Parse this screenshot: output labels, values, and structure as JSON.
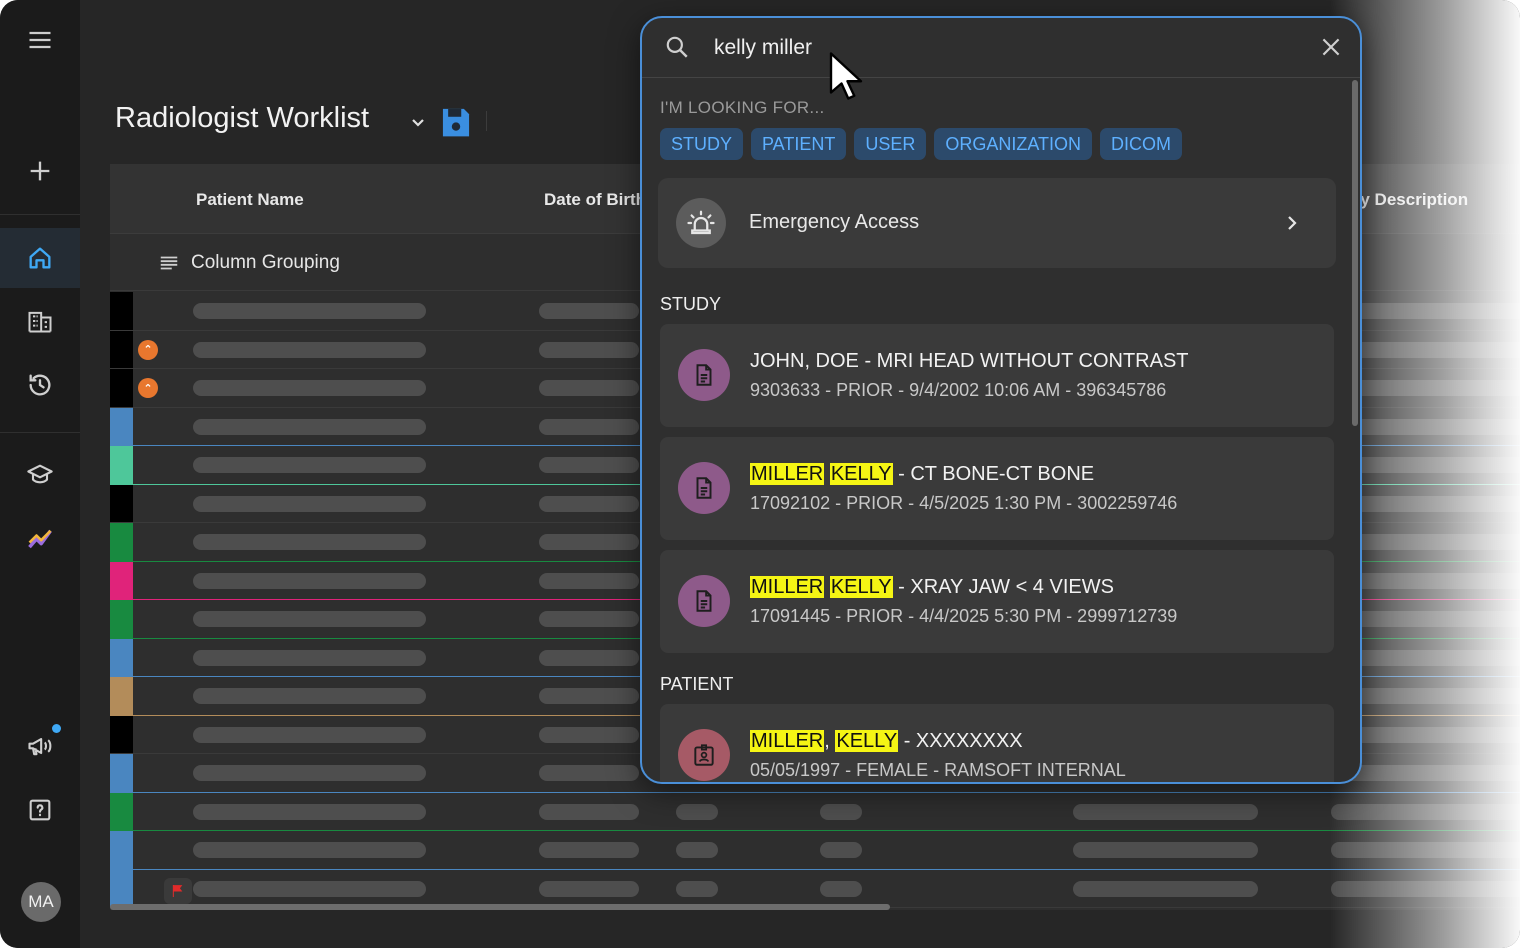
{
  "sidebar": {
    "items": [
      {
        "name": "menu",
        "icon": "hamburger-icon"
      },
      {
        "name": "add",
        "icon": "plus-icon"
      },
      {
        "name": "home",
        "icon": "home-icon",
        "active": true
      },
      {
        "name": "worklist",
        "icon": "building-icon"
      },
      {
        "name": "history",
        "icon": "history-icon"
      },
      {
        "name": "teaching",
        "icon": "graduation-cap-icon"
      },
      {
        "name": "analytics",
        "icon": "chart-icon"
      },
      {
        "name": "announcements",
        "icon": "megaphone-icon"
      },
      {
        "name": "help",
        "icon": "help-icon"
      }
    ],
    "avatar_initials": "MA",
    "accent_color": "#3fa9f5"
  },
  "header": {
    "title": "Radiologist Worklist"
  },
  "table": {
    "columns": [
      "Patient Name",
      "Date of Birth",
      "dy Description"
    ],
    "grouping_label": "Column Grouping",
    "row_colors": [
      "#000000",
      "#000000",
      "#000000",
      "#4a86c0",
      "#4ec79a",
      "#000000",
      "#188a40",
      "#e0237a",
      "#188a40",
      "#4a86c0",
      "#b38c5a",
      "#000000",
      "#4a86c0",
      "#188a40",
      "#4a86c0",
      "#4a86c0"
    ],
    "priority_rows": [
      1,
      2
    ],
    "flag_row": 15
  },
  "search": {
    "query": "kelly miller",
    "looking_for_label": "I'M LOOKING FOR...",
    "chips": [
      "STUDY",
      "PATIENT",
      "USER",
      "ORGANIZATION",
      "DICOM"
    ],
    "emergency_label": "Emergency Access",
    "study_section_label": "STUDY",
    "patient_section_label": "PATIENT",
    "studies": [
      {
        "title": "JOHN, DOE - MRI HEAD WITHOUT CONTRAST",
        "subtitle": "9303633 - PRIOR - 9/4/2002 10:06 AM - 396345786"
      },
      {
        "title_parts": [
          "MILLER",
          " ",
          "KELLY",
          " - CT BONE-CT BONE"
        ],
        "subtitle": "17092102 - PRIOR - 4/5/2025 1:30 PM - 3002259746"
      },
      {
        "title_parts": [
          "MILLER",
          " ",
          "KELLY",
          " - XRAY JAW < 4 VIEWS"
        ],
        "subtitle": "17091445 - PRIOR - 4/4/2025 5:30 PM - 2999712739"
      }
    ],
    "patients": [
      {
        "title_parts": [
          "MILLER",
          ", ",
          "KELLY",
          " - XXXXXXXX"
        ],
        "subtitle": "05/05/1997 - FEMALE - RAMSOFT INTERNAL"
      }
    ],
    "highlight_color": "#f5f514",
    "border_color": "#4a8fd8"
  }
}
